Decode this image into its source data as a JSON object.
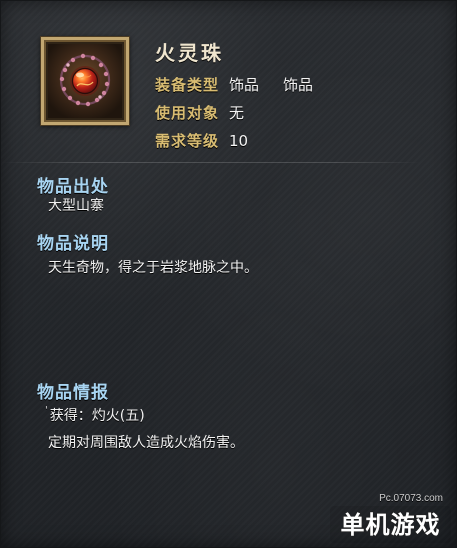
{
  "item": {
    "name": "火灵珠",
    "icon": "fire-spirit-bead-necklace-icon"
  },
  "stats": {
    "equipment_type_label": "装备类型",
    "equipment_type_value_1": "饰品",
    "equipment_type_value_2": "饰品",
    "target_label": "使用对象",
    "target_value": "无",
    "level_label": "需求等级",
    "level_value": "10"
  },
  "sections": {
    "source_title": "物品出处",
    "source_text": "大型山寨",
    "description_title": "物品说明",
    "description_text": "天生奇物，得之于岩浆地脉之中。",
    "info_title": "物品情报",
    "info_line_1": "获得：灼火(五)",
    "info_line_2": "定期对周围敌人造成火焰伤害。"
  },
  "watermark": {
    "url_text": "Pc.07073.com",
    "brand_text": "单机游戏"
  },
  "colors": {
    "background": "#25282c",
    "title_text": "#f0e6cf",
    "label_gold": "#d8bc72",
    "section_blue": "#a8d5f2",
    "body_text": "#f2f2f2",
    "frame_gold": "#c2a771",
    "bead_red": "#d33a24"
  }
}
